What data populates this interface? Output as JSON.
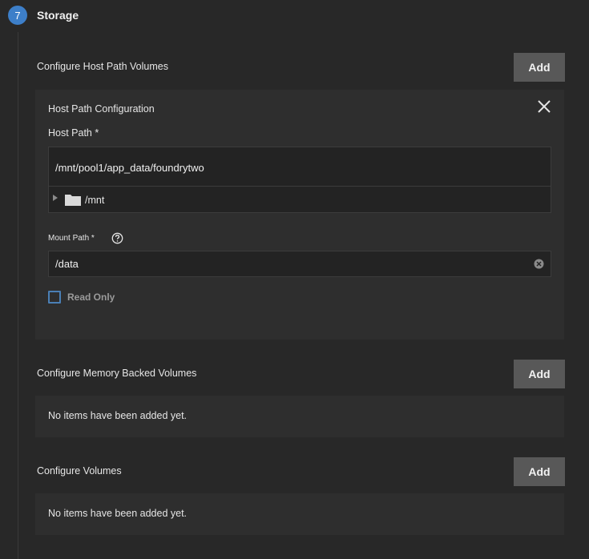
{
  "step": {
    "number": "7",
    "title": "Storage"
  },
  "host_path_volumes": {
    "label": "Configure Host Path Volumes",
    "add_label": "Add",
    "card": {
      "title": "Host Path Configuration",
      "close_icon": "close-icon",
      "host_path": {
        "label": "Host Path *",
        "value": "/mnt/pool1/app_data/foundrytwo",
        "tree_root": "/mnt",
        "folder_icon": "folder-icon"
      },
      "mount_path": {
        "label": "Mount Path *",
        "value": "/data",
        "help_icon": "help-circle-icon",
        "clear_icon": "clear-icon"
      },
      "read_only": {
        "label": "Read Only",
        "checked": false
      }
    }
  },
  "memory_backed_volumes": {
    "label": "Configure Memory Backed Volumes",
    "add_label": "Add",
    "empty_text": "No items have been added yet."
  },
  "volumes": {
    "label": "Configure Volumes",
    "add_label": "Add",
    "empty_text": "No items have been added yet."
  },
  "colors": {
    "background": "#282828",
    "card": "#2e2e2e",
    "accent": "#3d7fc9",
    "button": "#585858"
  }
}
